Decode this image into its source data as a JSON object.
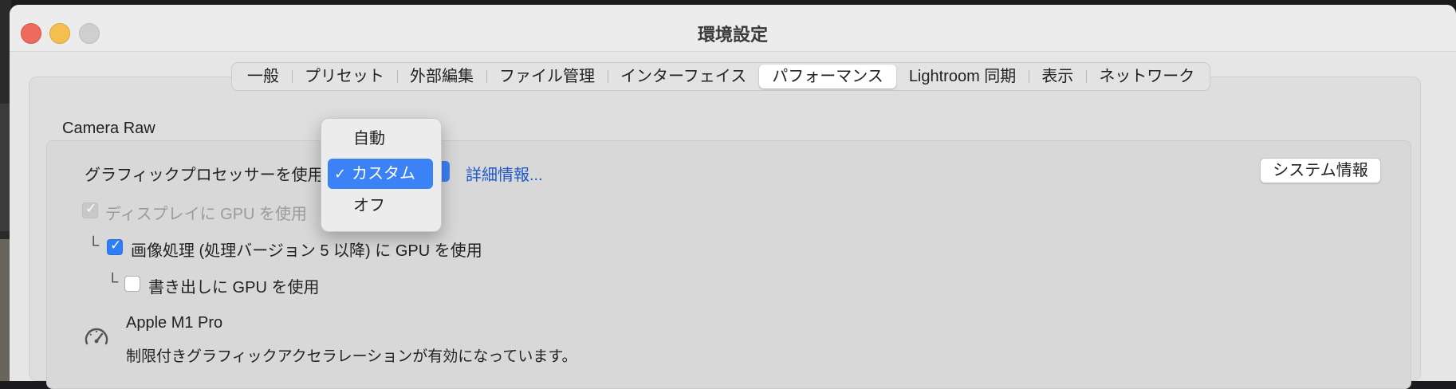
{
  "window": {
    "title": "環境設定"
  },
  "tabs": [
    {
      "label": "一般",
      "active": false
    },
    {
      "label": "プリセット",
      "active": false
    },
    {
      "label": "外部編集",
      "active": false
    },
    {
      "label": "ファイル管理",
      "active": false
    },
    {
      "label": "インターフェイス",
      "active": false
    },
    {
      "label": "パフォーマンス",
      "active": true
    },
    {
      "label": "Lightroom 同期",
      "active": false
    },
    {
      "label": "表示",
      "active": false
    },
    {
      "label": "ネットワーク",
      "active": false
    }
  ],
  "camera_raw": {
    "heading": "Camera Raw",
    "gpu_label": "グラフィックプロセッサーを使用：",
    "details_link": "詳細情報...",
    "system_info_button": "システム情報",
    "display_gpu": {
      "label": "ディスプレイに GPU を使用",
      "checked": true,
      "enabled": false
    },
    "image_processing": {
      "prefix": "└",
      "label": "画像処理 (処理バージョン 5 以降) に GPU を使用",
      "checked": true
    },
    "export": {
      "prefix": "└",
      "label": "書き出しに GPU を使用",
      "checked": false
    },
    "gpu_name": "Apple M1 Pro",
    "gpu_status": "制限付きグラフィックアクセラレーションが有効になっています。",
    "gauge_icon": "speedometer-icon"
  },
  "gpu_menu": {
    "options": [
      "自動",
      "カスタム",
      "オフ"
    ],
    "selected": "カスタム",
    "check_glyph": "✓"
  },
  "colors": {
    "accent": "#3b82f6",
    "link": "#1f57c7",
    "close": "#ed6a5e",
    "minimize": "#f4bf4f",
    "zoom_disabled": "#cfcfcf"
  }
}
